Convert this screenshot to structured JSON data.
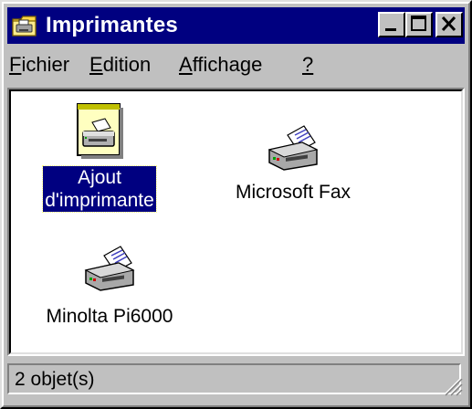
{
  "window": {
    "title": "Imprimantes",
    "title_icon": "printers-folder-icon",
    "buttons": [
      "minimize",
      "maximize",
      "close"
    ]
  },
  "menu": {
    "items": [
      {
        "accel": "F",
        "rest": "ichier"
      },
      {
        "accel": "E",
        "rest": "dition"
      },
      {
        "accel": "A",
        "rest": "ffichage"
      },
      {
        "accel": "?",
        "rest": ""
      }
    ]
  },
  "icons": {
    "items": [
      {
        "line1": "Ajout",
        "line2": "d'imprimante",
        "icon": "add-printer-icon",
        "selected": true
      },
      {
        "line1": "Microsoft Fax",
        "line2": "",
        "icon": "printer-icon",
        "selected": false
      },
      {
        "line1": "Minolta Pi6000",
        "line2": "",
        "icon": "printer-icon",
        "selected": false
      }
    ]
  },
  "status": {
    "text": "2 objet(s)"
  },
  "colors": {
    "titlebar": "#000080",
    "face": "#c0c0c0",
    "selection": "#000080"
  }
}
